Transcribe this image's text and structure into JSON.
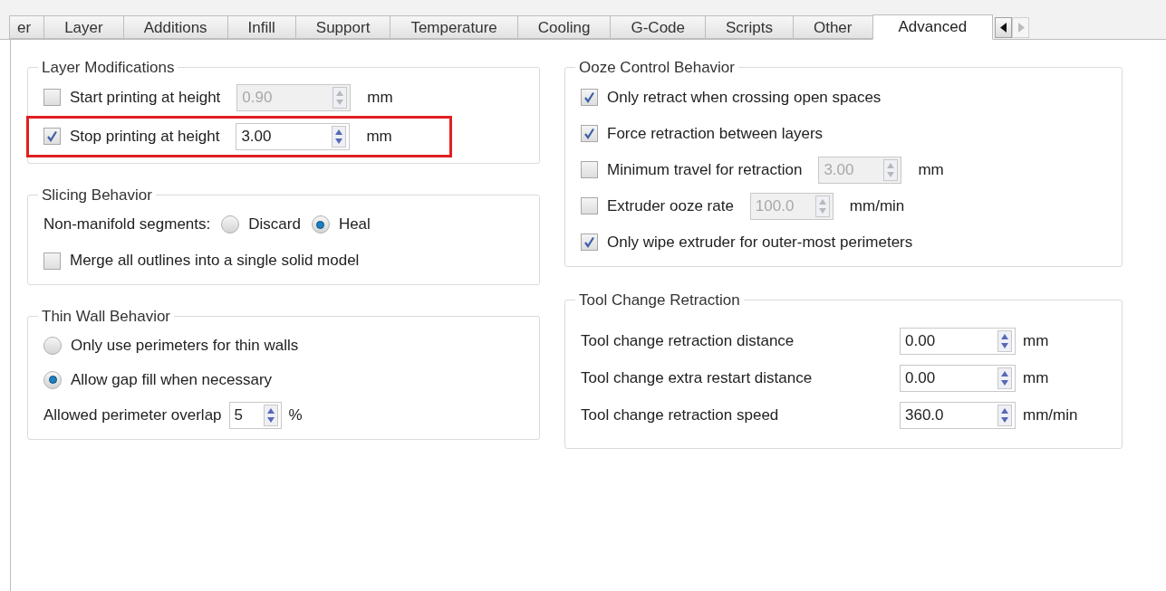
{
  "tabs": [
    {
      "label": "er",
      "selected": false
    },
    {
      "label": "Layer",
      "selected": false
    },
    {
      "label": "Additions",
      "selected": false
    },
    {
      "label": "Infill",
      "selected": false
    },
    {
      "label": "Support",
      "selected": false
    },
    {
      "label": "Temperature",
      "selected": false
    },
    {
      "label": "Cooling",
      "selected": false
    },
    {
      "label": "G-Code",
      "selected": false
    },
    {
      "label": "Scripts",
      "selected": false
    },
    {
      "label": "Other",
      "selected": false
    },
    {
      "label": "Advanced",
      "selected": true
    }
  ],
  "left_groups": [
    {
      "title": "Layer Modifications",
      "rows": [
        {
          "kind": "check_spin",
          "label": "Start printing at height",
          "checked": false,
          "value": "0.90",
          "unit": "mm",
          "disabled": true,
          "highlighted": false
        },
        {
          "kind": "check_spin",
          "label": "Stop printing at height",
          "checked": true,
          "value": "3.00",
          "unit": "mm",
          "disabled": false,
          "highlighted": true
        }
      ]
    },
    {
      "title": "Slicing Behavior",
      "rows": [
        {
          "kind": "radio_group",
          "label": "Non-manifold segments:",
          "options": [
            {
              "label": "Discard",
              "selected": false
            },
            {
              "label": "Heal",
              "selected": true
            }
          ]
        },
        {
          "kind": "check",
          "label": "Merge all outlines into a single solid model",
          "checked": false
        }
      ]
    },
    {
      "title": "Thin Wall Behavior",
      "rows": [
        {
          "kind": "radio",
          "label": "Only use perimeters for thin walls",
          "selected": false
        },
        {
          "kind": "radio",
          "label": "Allow gap fill when necessary",
          "selected": true
        },
        {
          "kind": "spin",
          "label": "Allowed perimeter overlap",
          "value": "5",
          "unit": "%"
        }
      ]
    }
  ],
  "right_groups": [
    {
      "title": "Ooze Control Behavior",
      "rows": [
        {
          "kind": "check",
          "label": "Only retract when crossing open spaces",
          "checked": true
        },
        {
          "kind": "check",
          "label": "Force retraction between layers",
          "checked": true
        },
        {
          "kind": "check_spin",
          "label": "Minimum travel for retraction",
          "checked": false,
          "value": "3.00",
          "unit": "mm",
          "disabled": true
        },
        {
          "kind": "check_spin",
          "label": "Extruder ooze rate",
          "checked": false,
          "value": "100.0",
          "unit": "mm/min",
          "disabled": true
        },
        {
          "kind": "check",
          "label": "Only wipe extruder for outer-most perimeters",
          "checked": true
        }
      ]
    },
    {
      "title": "Tool Change Retraction",
      "rows": [
        {
          "kind": "grid_spin",
          "label": "Tool change retraction distance",
          "value": "0.00",
          "unit": "mm"
        },
        {
          "kind": "grid_spin",
          "label": "Tool change extra restart distance",
          "value": "0.00",
          "unit": "mm"
        },
        {
          "kind": "grid_spin",
          "label": "Tool change retraction speed",
          "value": "360.0",
          "unit": "mm/min"
        }
      ]
    }
  ]
}
